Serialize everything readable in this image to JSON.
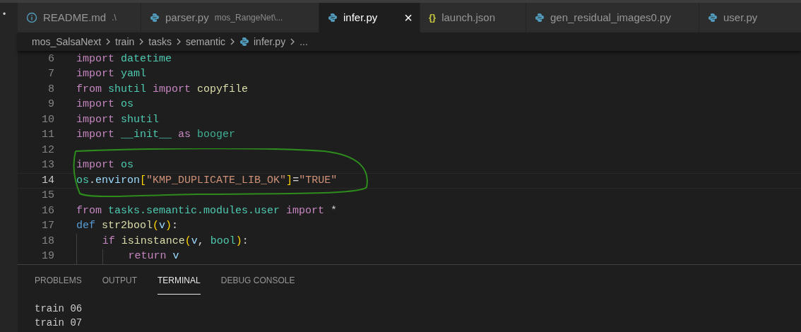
{
  "activity_bar": {
    "marker": "•"
  },
  "tabs": [
    {
      "label": "README.md",
      "description": ".\\",
      "kind": "info",
      "selected": false
    },
    {
      "label": "parser.py",
      "description": "mos_RangeNet\\...",
      "kind": "python",
      "selected": false
    },
    {
      "label": "infer.py",
      "kind": "python",
      "selected": true,
      "close": "×"
    },
    {
      "label": "launch.json",
      "kind": "json",
      "icon_text": "{}",
      "selected": false
    },
    {
      "label": "gen_residual_images0.py",
      "kind": "python",
      "selected": false
    },
    {
      "label": "user.py",
      "kind": "python",
      "selected": false
    }
  ],
  "breadcrumb": [
    {
      "label": "mos_SalsaNext",
      "kind": "folder"
    },
    {
      "label": "train",
      "kind": "folder"
    },
    {
      "label": "tasks",
      "kind": "folder"
    },
    {
      "label": "semantic",
      "kind": "folder"
    },
    {
      "label": "infer.py",
      "kind": "python"
    },
    {
      "label": "...",
      "kind": "symbol"
    }
  ],
  "code_lines": [
    {
      "number": "6",
      "current": false,
      "tokens": [
        {
          "kind": "keyword",
          "text": "import"
        },
        {
          "kind": "module",
          "text": " datetime"
        }
      ]
    },
    {
      "number": "7",
      "current": false,
      "tokens": [
        {
          "kind": "keyword",
          "text": "import"
        },
        {
          "kind": "module",
          "text": " yaml"
        }
      ]
    },
    {
      "number": "8",
      "current": false,
      "tokens": [
        {
          "kind": "keyword",
          "text": "from"
        },
        {
          "kind": "module",
          "text": " shutil"
        },
        {
          "kind": "keyword",
          "text": " import"
        },
        {
          "kind": "function",
          "text": " copyfile"
        }
      ]
    },
    {
      "number": "9",
      "current": false,
      "tokens": [
        {
          "kind": "keyword",
          "text": "import"
        },
        {
          "kind": "module",
          "text": " os"
        }
      ]
    },
    {
      "number": "10",
      "current": false,
      "tokens": [
        {
          "kind": "keyword",
          "text": "import"
        },
        {
          "kind": "module",
          "text": " shutil"
        }
      ]
    },
    {
      "number": "11",
      "current": false,
      "tokens": [
        {
          "kind": "keyword",
          "text": "import"
        },
        {
          "kind": "module",
          "text": " __init__"
        },
        {
          "kind": "keyword",
          "text": " as"
        },
        {
          "kind": "alias",
          "text": " booger"
        }
      ]
    },
    {
      "number": "12",
      "current": false
    },
    {
      "number": "13",
      "current": false,
      "tokens": [
        {
          "kind": "keyword",
          "text": "import"
        },
        {
          "kind": "module",
          "text": " os"
        }
      ]
    },
    {
      "number": "14",
      "current": true,
      "tokens": [
        {
          "kind": "module",
          "text": "os"
        },
        {
          "kind": "plain",
          "text": "."
        },
        {
          "kind": "variable",
          "text": "environ"
        },
        {
          "kind": "bracket",
          "text": "["
        },
        {
          "kind": "string",
          "text": "\"KMP_DUPLICATE_LIB_OK\""
        },
        {
          "kind": "bracket",
          "text": "]"
        },
        {
          "kind": "plain",
          "text": "="
        },
        {
          "kind": "string",
          "text": "\"TRUE\""
        }
      ]
    },
    {
      "number": "15",
      "current": false
    },
    {
      "number": "16",
      "current": false,
      "tokens": [
        {
          "kind": "keyword",
          "text": "from"
        },
        {
          "kind": "module",
          "text": " tasks.semantic.modules.user"
        },
        {
          "kind": "keyword",
          "text": " import"
        },
        {
          "kind": "plain",
          "text": " *"
        }
      ]
    },
    {
      "number": "17",
      "current": false,
      "tokens": [
        {
          "kind": "storage",
          "text": "def"
        },
        {
          "kind": "function",
          "text": " str2bool"
        },
        {
          "kind": "bracket",
          "text": "("
        },
        {
          "kind": "variable",
          "text": "v"
        },
        {
          "kind": "bracket",
          "text": ")"
        },
        {
          "kind": "plain",
          "text": ":"
        }
      ],
      "children": [
        {
          "number": "18",
          "current": false,
          "tokens": [
            {
              "kind": "keyword",
              "text": "if"
            },
            {
              "kind": "function",
              "text": " isinstance"
            },
            {
              "kind": "bracket",
              "text": "("
            },
            {
              "kind": "variable",
              "text": "v"
            },
            {
              "kind": "plain",
              "text": ","
            },
            {
              "kind": "module",
              "text": " bool"
            },
            {
              "kind": "bracket",
              "text": ")"
            },
            {
              "kind": "plain",
              "text": ":"
            }
          ],
          "children": [
            {
              "number": "19",
              "current": false,
              "tokens": [
                {
                  "kind": "keyword",
                  "text": "return"
                },
                {
                  "kind": "variable",
                  "text": " v"
                }
              ]
            }
          ]
        }
      ]
    }
  ],
  "panel_tabs": [
    {
      "label": "PROBLEMS",
      "selected": false
    },
    {
      "label": "OUTPUT",
      "selected": false
    },
    {
      "label": "TERMINAL",
      "selected": true
    },
    {
      "label": "DEBUG CONSOLE",
      "selected": false
    }
  ],
  "terminal_lines": [
    "train 06",
    "train 07"
  ]
}
